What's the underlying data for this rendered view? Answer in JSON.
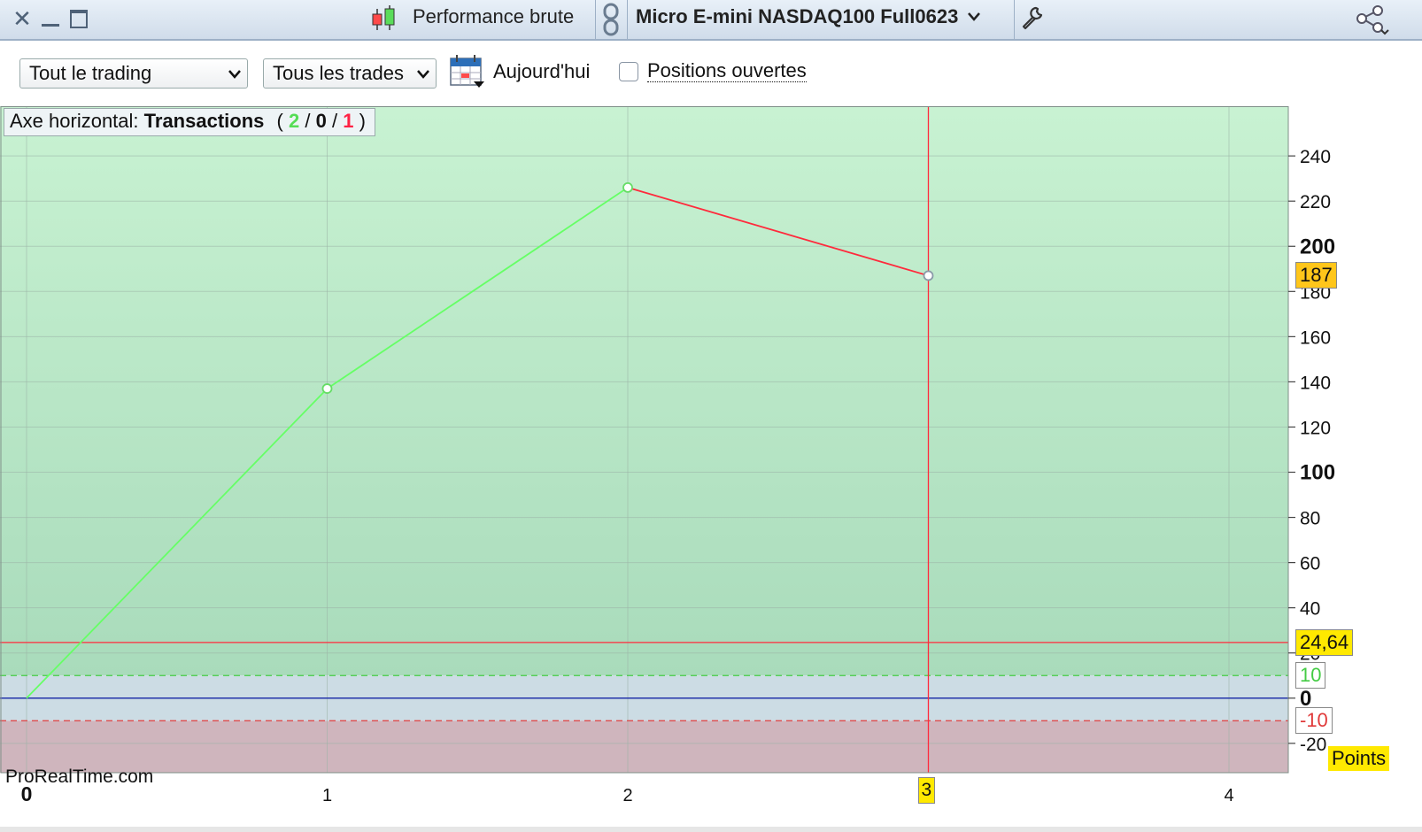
{
  "window": {
    "close_icon": "close-icon",
    "minimize_icon": "minimize-icon",
    "maximize_icon": "maximize-icon",
    "chart_type_icon": "candlestick-icon",
    "title": "Performance brute",
    "link_icon": "link-icon",
    "instrument": "Micro E-mini NASDAQ100 Full0623",
    "instrument_chevron": "chevron-down-icon",
    "settings_icon": "wrench-icon",
    "share_icon": "share-icon"
  },
  "toolbar": {
    "scope_select": {
      "value": "Tout le trading"
    },
    "trades_select": {
      "value": "Tous les trades"
    },
    "calendar_icon": "calendar-icon",
    "date_label": "Aujourd'hui",
    "open_positions": {
      "label": "Positions ouvertes",
      "checked": false
    }
  },
  "axis_info": {
    "label": "Axe horizontal:",
    "mode": "Transactions",
    "open_paren": "(",
    "winners": "2",
    "slash1": "/",
    "neutral": "0",
    "slash2": "/",
    "losers": "1",
    "close_paren": ")"
  },
  "watermark": "ProRealTime.com",
  "colors": {
    "gain_line": "#66ff66",
    "loss_line": "#ff2a3c",
    "zero_line": "#2233aa",
    "positive_zone": "#c8f0d0",
    "negative_zone": "#cfb5bd",
    "highlight_label": "#ffe900",
    "current_value_label": "#ffc61a"
  },
  "chart_data": {
    "type": "line",
    "x": [
      0,
      1,
      2,
      3
    ],
    "y": [
      0,
      137,
      226,
      187
    ],
    "segment_colors": [
      "#66ff66",
      "#66ff66",
      "#ff2a3c"
    ],
    "xlim": [
      0,
      4.2
    ],
    "ylim": [
      -33,
      262
    ],
    "y_ticks": [
      -20,
      0,
      20,
      40,
      60,
      80,
      100,
      120,
      140,
      160,
      180,
      200,
      220,
      240
    ],
    "y_tick_labels": [
      "-20",
      "0",
      "20",
      "40",
      "60",
      "80",
      "100",
      "120",
      "140",
      "160",
      "180",
      "200",
      "220",
      "240"
    ],
    "x_ticks": [
      0,
      1,
      2,
      3,
      4
    ],
    "x_tick_labels": [
      "0",
      "1",
      "2",
      "3",
      "4"
    ],
    "grid": true,
    "unit_label": "Points",
    "current_value": {
      "value": 187,
      "label": "187"
    },
    "average_line": {
      "value": 24.64,
      "label": "24,64"
    },
    "upper_band": {
      "value": 10,
      "label": "10"
    },
    "lower_band": {
      "value": -10,
      "label": "-10"
    },
    "cursor_x": {
      "value": 3,
      "label": "3"
    }
  }
}
